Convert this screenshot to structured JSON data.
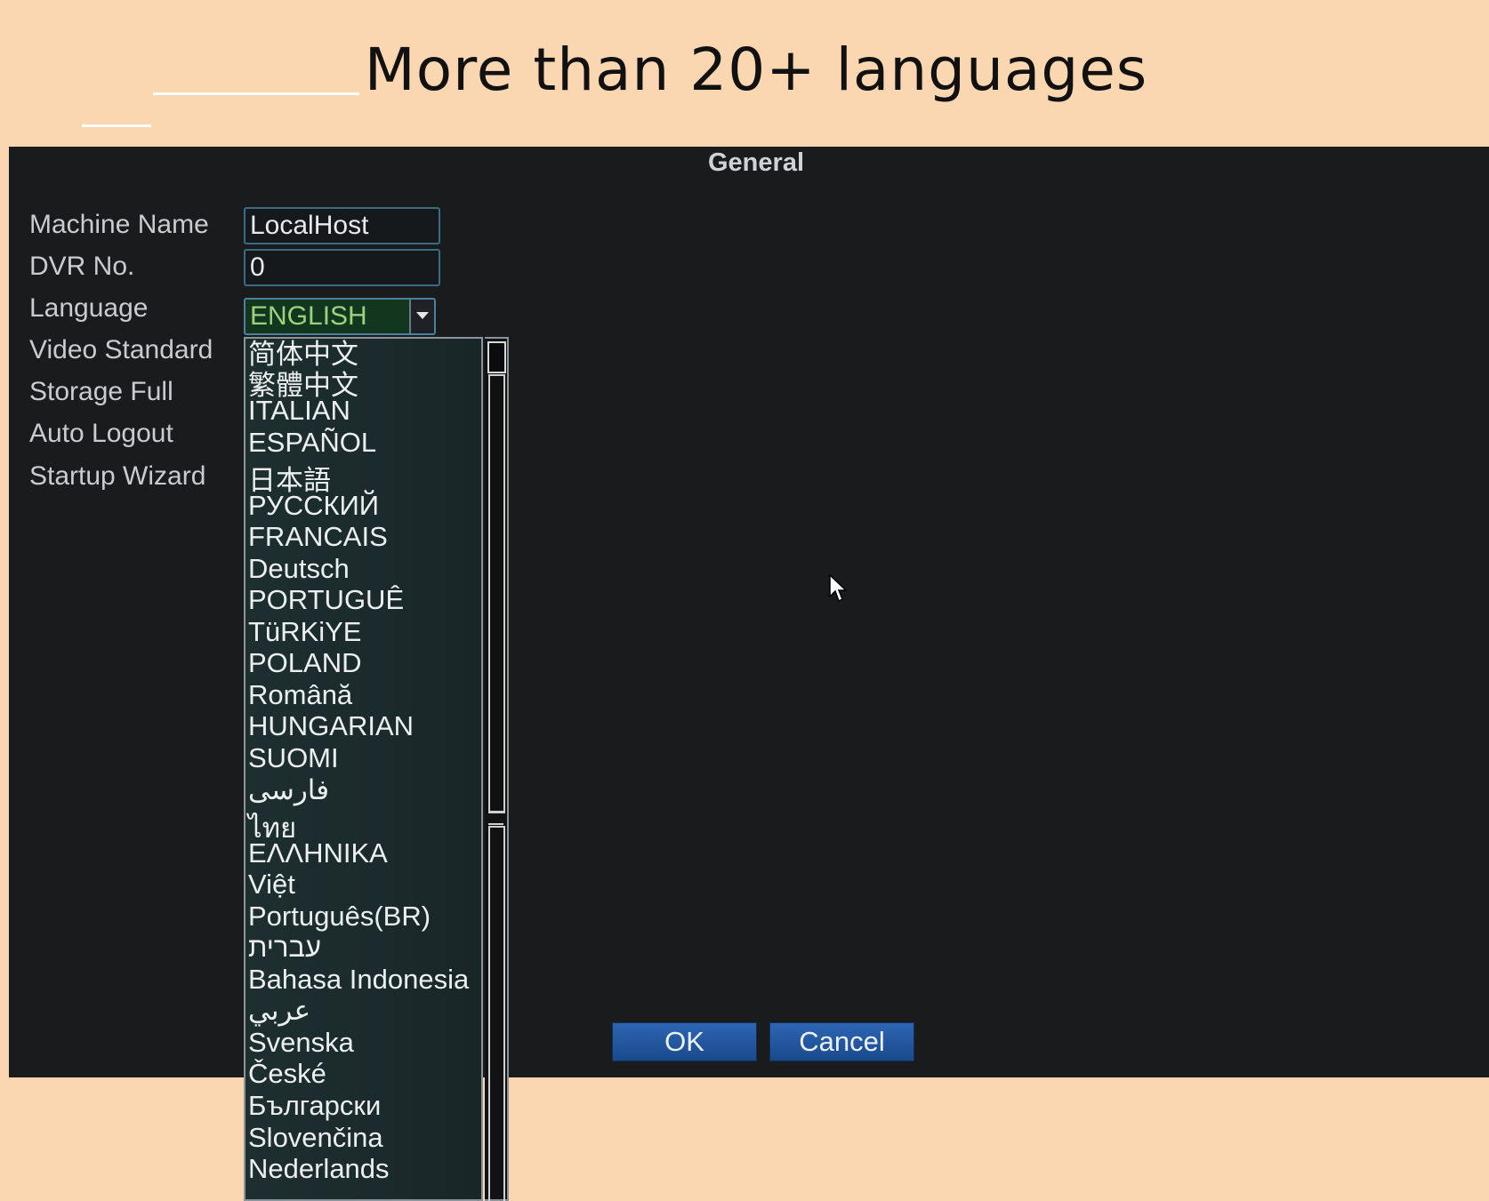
{
  "banner": {
    "title": "More than 20+ languages"
  },
  "window": {
    "title": "General"
  },
  "form": {
    "machine_name": {
      "label": "Machine Name",
      "value": "LocalHost"
    },
    "dvr_no": {
      "label": "DVR No.",
      "value": "0"
    },
    "language": {
      "label": "Language",
      "value": "ENGLISH"
    },
    "video_standard": {
      "label": "Video Standard"
    },
    "storage_full": {
      "label": "Storage Full"
    },
    "auto_logout": {
      "label": "Auto Logout"
    },
    "startup_wizard": {
      "label": "Startup Wizard"
    }
  },
  "language_options": [
    "简体中文",
    "繁體中文",
    "ITALIAN",
    "ESPAÑOL",
    "日本語",
    "РУССКИЙ",
    "FRANCAIS",
    "Deutsch",
    "PORTUGUÊ",
    "TüRKiYE",
    "POLAND",
    "Română",
    "HUNGARIAN",
    "SUOMI",
    "فارسی",
    "ไทย",
    "ΕΛΛΗΝΙΚΑ",
    "Việt",
    "Português(BR)",
    "עברית",
    "Bahasa Indonesia",
    "عربي",
    "Svenska",
    "České",
    "Български",
    "Slovenčina",
    "Nederlands"
  ],
  "buttons": {
    "ok": "OK",
    "cancel": "Cancel"
  }
}
